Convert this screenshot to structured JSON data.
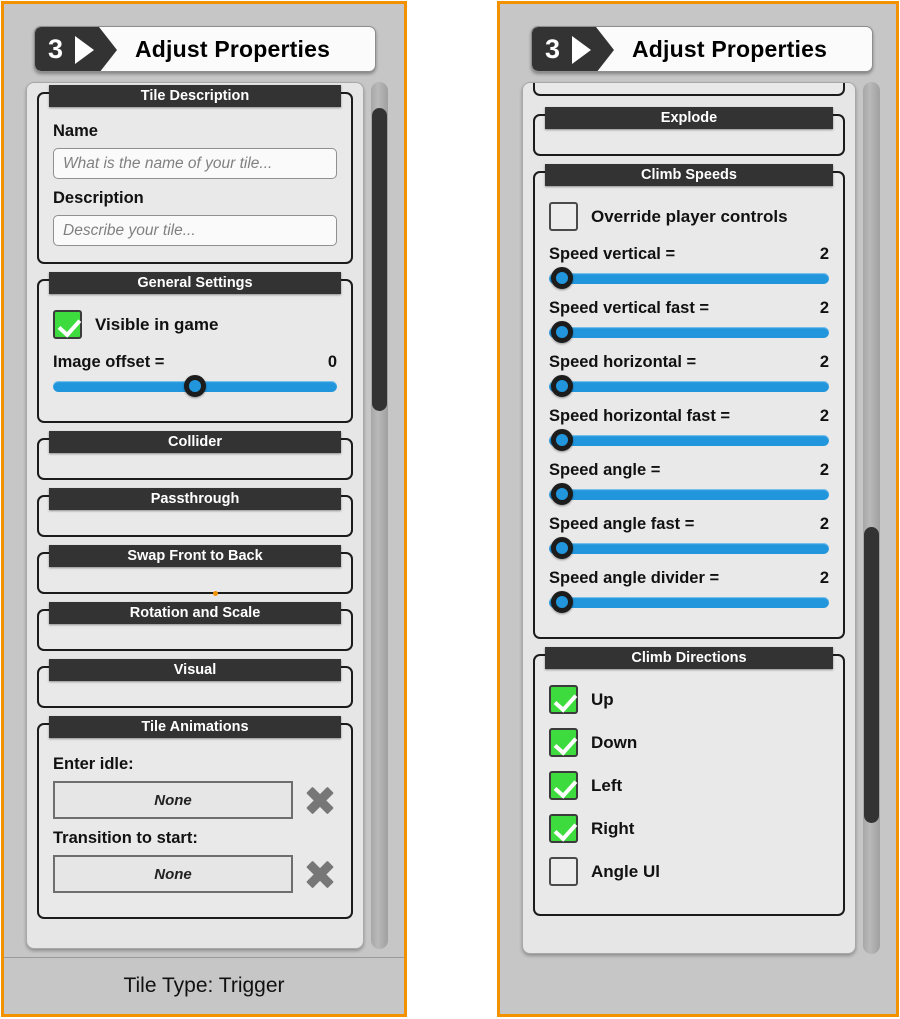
{
  "theme": {
    "accent_orange": "#f39200",
    "slider_blue": "#2196dd",
    "check_green": "#3ddb3d",
    "header_dark": "#333333",
    "panel_gray": "#c6c6c6"
  },
  "left_panel": {
    "header": {
      "step_number": "3",
      "title": "Adjust Properties"
    },
    "footer": {
      "text": "Tile Type: Trigger"
    },
    "scrollbar": {
      "thumb_top_pct": 3,
      "thumb_height_pct": 35
    },
    "sections": [
      {
        "title": "Tile Description",
        "fields": [
          {
            "label": "Name",
            "placeholder": "What is the name of your tile...",
            "value": ""
          },
          {
            "label": "Description",
            "placeholder": "Describe your tile...",
            "value": ""
          }
        ]
      },
      {
        "title": "General Settings",
        "checkbox": {
          "label": "Visible in game",
          "checked": true
        },
        "slider": {
          "label": "Image offset =",
          "value": "0",
          "fill_pct": 50
        }
      },
      {
        "title": "Collider",
        "collapsed": true
      },
      {
        "title": "Passthrough",
        "collapsed": true
      },
      {
        "title": "Swap Front to Back",
        "collapsed": true
      },
      {
        "title": "Rotation and Scale",
        "collapsed": true
      },
      {
        "title": "Visual",
        "collapsed": true
      },
      {
        "title": "Tile Animations",
        "anim_rows": [
          {
            "label": "Enter idle:",
            "value": "None",
            "clear_icon": "x-icon"
          },
          {
            "label": "Transition to start:",
            "value": "None",
            "clear_icon": "x-icon"
          }
        ]
      }
    ]
  },
  "right_panel": {
    "header": {
      "step_number": "3",
      "title": "Adjust Properties"
    },
    "scrollbar": {
      "thumb_top_pct": 51,
      "thumb_height_pct": 34
    },
    "sections": [
      {
        "title": "Explode",
        "collapsed": true
      },
      {
        "title": "Climb Speeds",
        "checkbox": {
          "label": "Override player controls",
          "checked": false
        },
        "sliders": [
          {
            "label": "Speed vertical =",
            "value": "2",
            "fill_pct": 4
          },
          {
            "label": "Speed vertical fast =",
            "value": "2",
            "fill_pct": 4
          },
          {
            "label": "Speed horizontal =",
            "value": "2",
            "fill_pct": 4
          },
          {
            "label": "Speed horizontal fast =",
            "value": "2",
            "fill_pct": 4
          },
          {
            "label": "Speed angle =",
            "value": "2",
            "fill_pct": 4
          },
          {
            "label": "Speed angle fast =",
            "value": "2",
            "fill_pct": 4
          },
          {
            "label": "Speed angle divider =",
            "value": "2",
            "fill_pct": 4
          }
        ]
      },
      {
        "title": "Climb Directions",
        "checkboxes": [
          {
            "label": "Up",
            "checked": true
          },
          {
            "label": "Down",
            "checked": true
          },
          {
            "label": "Left",
            "checked": true
          },
          {
            "label": "Right",
            "checked": true
          },
          {
            "label": "Angle Ul",
            "checked": false
          }
        ]
      }
    ]
  }
}
